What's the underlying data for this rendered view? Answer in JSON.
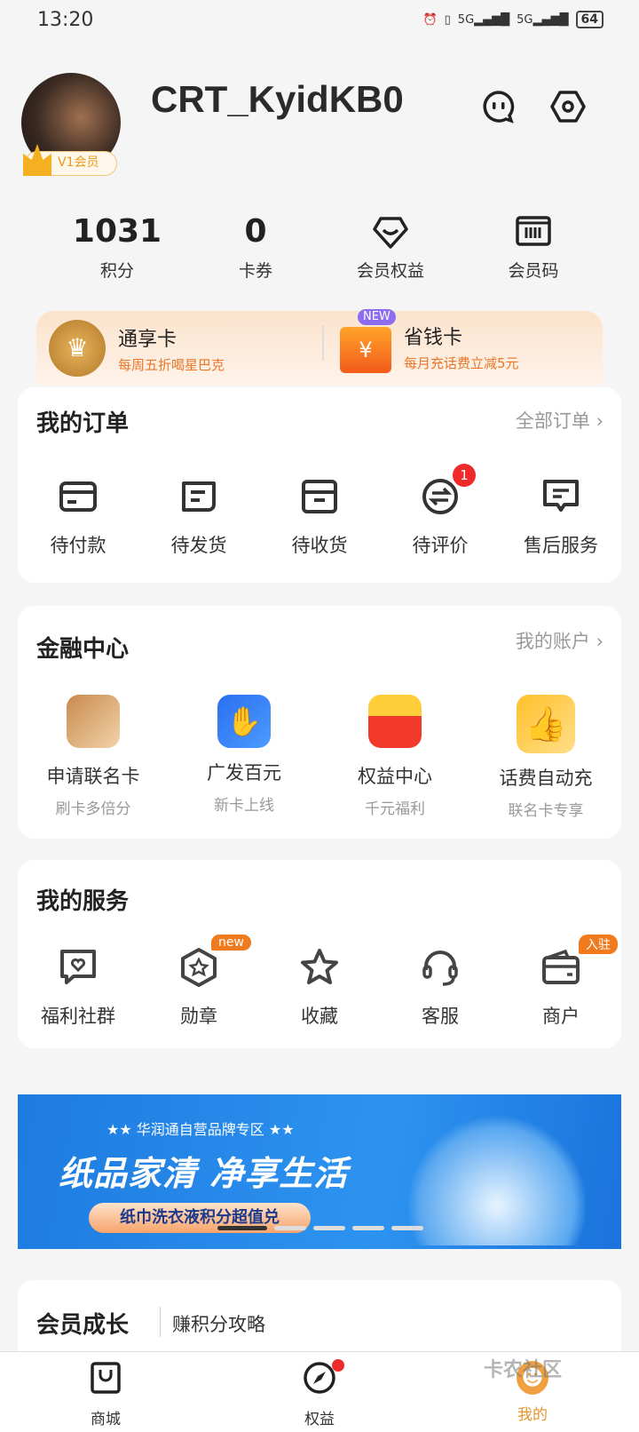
{
  "status_bar": {
    "time": "13:20",
    "battery": "64",
    "net1": "5G",
    "net2": "5G"
  },
  "profile": {
    "username": "CRT_KyidKB0",
    "vip_label": "V1会员"
  },
  "stats": [
    {
      "value": "1031",
      "label": "积分"
    },
    {
      "value": "0",
      "label": "卡券"
    },
    {
      "icon": "diamond-icon",
      "label": "会员权益"
    },
    {
      "icon": "barcode-icon",
      "label": "会员码"
    }
  ],
  "promo_cards": [
    {
      "title": "通享卡",
      "subtitle": "每周五折喝星巴克"
    },
    {
      "title": "省钱卡",
      "subtitle": "每月充话费立减5元",
      "badge": "NEW",
      "icon_text": "¥"
    }
  ],
  "orders": {
    "title": "我的订单",
    "link": "全部订单",
    "items": [
      {
        "label": "待付款"
      },
      {
        "label": "待发货"
      },
      {
        "label": "待收货"
      },
      {
        "label": "待评价",
        "badge": "1"
      },
      {
        "label": "售后服务"
      }
    ]
  },
  "finance": {
    "title": "金融中心",
    "link": "我的账户",
    "items": [
      {
        "label": "申请联名卡",
        "sub": "刷卡多倍分"
      },
      {
        "label": "广发百元",
        "sub": "新卡上线"
      },
      {
        "label": "权益中心",
        "sub": "千元福利"
      },
      {
        "label": "话费自动充",
        "sub": "联名卡专享"
      }
    ]
  },
  "services": {
    "title": "我的服务",
    "items": [
      {
        "label": "福利社群"
      },
      {
        "label": "勋章",
        "badge": "new"
      },
      {
        "label": "收藏"
      },
      {
        "label": "客服"
      },
      {
        "label": "商户",
        "badge": "入驻"
      }
    ]
  },
  "banner": {
    "tag": "华润通自营品牌专区",
    "headline": "纸品家清 净享生活",
    "button": "纸巾洗衣液积分超值兑",
    "slides": 5,
    "active_slide": 1
  },
  "growth": {
    "title": "会员成长",
    "link": "赚积分攻略"
  },
  "bottom_nav": [
    {
      "label": "商城"
    },
    {
      "label": "权益",
      "dot": true
    },
    {
      "label": "我的",
      "active": true
    }
  ],
  "watermark": "卡农社区",
  "colors": {
    "accent": "#f07a1e",
    "active_tab": "#e8952a",
    "badge_red": "#ef2a2a"
  }
}
